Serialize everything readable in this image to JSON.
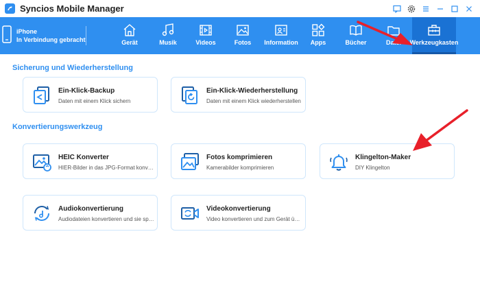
{
  "window": {
    "title": "Syncios Mobile Manager"
  },
  "device": {
    "name": "iPhone",
    "status": "In Verbindung gebracht"
  },
  "nav": [
    {
      "label": "Gerät",
      "icon": "home-icon"
    },
    {
      "label": "Musik",
      "icon": "music-icon"
    },
    {
      "label": "Videos",
      "icon": "video-icon"
    },
    {
      "label": "Fotos",
      "icon": "photo-icon"
    },
    {
      "label": "Information",
      "icon": "contact-card-icon"
    },
    {
      "label": "Apps",
      "icon": "apps-icon"
    },
    {
      "label": "Bücher",
      "icon": "book-icon"
    },
    {
      "label": "Datei",
      "icon": "folder-icon"
    },
    {
      "label": "Werkzeugkasten",
      "icon": "toolbox-icon",
      "active": true
    }
  ],
  "sections": {
    "backup": {
      "title": "Sicherung und Wiederherstellung",
      "cards": [
        {
          "title": "Ein-Klick-Backup",
          "desc": "Daten mit einem Klick sichern"
        },
        {
          "title": "Ein-Klick-Wiederherstellung",
          "desc": "Daten mit einem Klick wiederherstellen"
        }
      ]
    },
    "convert": {
      "title": "Konvertierungswerkzeug",
      "cards": [
        {
          "title": "HEIC Konverter",
          "desc": "HIER-Bilder in das JPG-Format konvertieren"
        },
        {
          "title": "Fotos komprimieren",
          "desc": "Kamerabilder komprimieren"
        },
        {
          "title": "Klingelton-Maker",
          "desc": "DIY Klingelton"
        },
        {
          "title": "Audiokonvertierung",
          "desc": "Audiodateien konvertieren und sie speichern"
        },
        {
          "title": "Videokonvertierung",
          "desc": "Video konvertieren und zum Gerät übertragen"
        }
      ]
    }
  },
  "colors": {
    "accent": "#2f8ff0",
    "active_tab": "#1a72d4",
    "card_border": "#cfe6fb",
    "arrow": "#e8202a"
  }
}
